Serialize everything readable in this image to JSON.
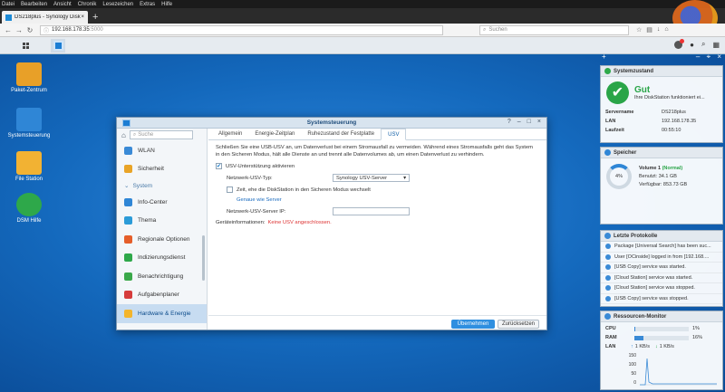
{
  "browser": {
    "menu": [
      "Datei",
      "Bearbeiten",
      "Ansicht",
      "Chronik",
      "Lesezeichen",
      "Extras",
      "Hilfe"
    ],
    "tab_title": "DS218plus - Synology DiskStation",
    "url_host": "192.168.178.35",
    "url_port": ":5000",
    "search_placeholder": "Suchen"
  },
  "desktop_icons": [
    {
      "label": "Paket-Zentrum",
      "color": "#e8a028"
    },
    {
      "label": "Systemsteuerung",
      "color": "#2f86d6"
    },
    {
      "label": "File Station",
      "color": "#f2b233"
    },
    {
      "label": "DSM Hilfe",
      "color": "#2ea84a"
    }
  ],
  "window": {
    "title": "Systemsteuerung",
    "search_placeholder": "Suche",
    "sidebar": {
      "items_top": [
        {
          "label": "WLAN",
          "color": "#3a8ad6"
        },
        {
          "label": "Sicherheit",
          "color": "#e9a427"
        }
      ],
      "group": "System",
      "items": [
        {
          "label": "Info-Center",
          "color": "#2f86d6"
        },
        {
          "label": "Thema",
          "color": "#2b9bd8"
        },
        {
          "label": "Regionale Optionen",
          "color": "#e55e2a"
        },
        {
          "label": "Indizierungsdienst",
          "color": "#2ea84a"
        },
        {
          "label": "Benachrichtigung",
          "color": "#3aa84a"
        },
        {
          "label": "Aufgabenplaner",
          "color": "#d63c3c"
        },
        {
          "label": "Hardware & Energie",
          "color": "#f3b52c"
        }
      ]
    },
    "tabs": [
      "Allgemein",
      "Energie-Zeitplan",
      "Ruhezustand der Festplatte",
      "USV"
    ],
    "active_tab": 3,
    "description": "Schließen Sie eine USB-USV an, um Datenverlust bei einem Stromausfall zu vermeiden. Während eines Stromausfalls geht das System in den Sicheren Modus, hält alle Dienste an und trennt alle Datenvolumes ab, um einen Datenverlust zu verhindern.",
    "enable_ups": "USV-Unterstützung aktivieren",
    "network_type_label": "Netzwerk-USV-Typ:",
    "network_type_value": "Synology USV-Server",
    "time_label": "Zeit, ehe die DiskStation in den Sicheren Modus wechselt",
    "permitted_link": "Genaue wie Server",
    "server_ip_label": "Netzwerk-USV-Server IP:",
    "device_info_label": "Geräteinformationen:",
    "device_info_value": "Keine USV angeschlossen.",
    "apply": "Übernehmen",
    "reset": "Zurücksetzen"
  },
  "widgets": {
    "system": {
      "title": "Systemzustand",
      "status": "Gut",
      "status_sub": "Ihre DiskStation funktioniert ei...",
      "rows": [
        {
          "k": "Servername",
          "v": "DS218plus"
        },
        {
          "k": "LAN",
          "v": "192.168.178.35"
        },
        {
          "k": "Laufzeit",
          "v": "00:55:10"
        }
      ]
    },
    "storage": {
      "title": "Speicher",
      "percent": "4%",
      "volume": "Volume 1",
      "volume_status": "(Normal)",
      "used": "Benutzt: 34.1 GB",
      "free": "Verfügbar: 853.73 GB"
    },
    "logs": {
      "title": "Letzte Protokolle",
      "items": [
        "Package [Universal Search] has been suc...",
        "User [OCinside] logged in from [192.168....",
        "[USB Copy] service was started.",
        "[Cloud Station] service was started.",
        "[Cloud Station] service was stopped.",
        "[USB Copy] service was stopped."
      ]
    },
    "resources": {
      "title": "Ressourcen-Monitor",
      "cpu_label": "CPU",
      "cpu_value": "1%",
      "cpu": 0.01,
      "ram_label": "RAM",
      "ram_value": "16%",
      "ram": 0.16,
      "lan_label": "LAN",
      "lan_up": "1 KB/s",
      "lan_down": "1 KB/s",
      "y_ticks": [
        "150",
        "100",
        "50",
        "0"
      ]
    }
  }
}
